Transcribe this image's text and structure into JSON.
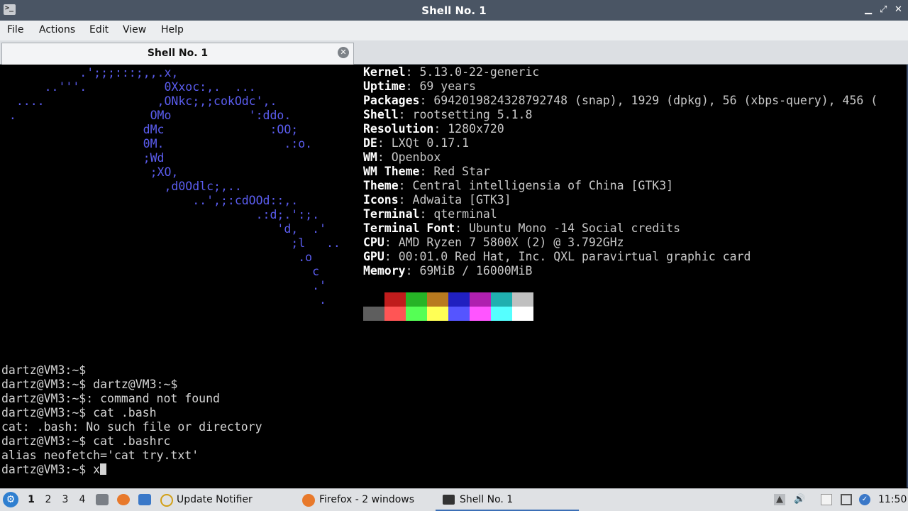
{
  "window": {
    "title": "Shell No. 1",
    "min_label": "▁",
    "max_label": "⤢",
    "close_label": "✕"
  },
  "menu": {
    "file": "File",
    "actions": "Actions",
    "edit": "Edit",
    "view": "View",
    "help": "Help"
  },
  "tab": {
    "label": "Shell No. 1"
  },
  "logo_lines": [
    "           .';;;:::;,,.x,",
    "      ..'''.           0Xxoc:,.  ...",
    "  ....                ,ONkc;,;cokOdc',.",
    " .                   OMo           ':ddo.",
    "                    dMc               :OO;",
    "                    0M.                 .:o.",
    "                    ;Wd",
    "                     ;XO,",
    "                       ,d0Odlc;,..",
    "                           ..',;:cdOOd::,.",
    "                                    .:d;.':;.",
    "                                       'd,  .'",
    "                                         ;l   ..",
    "                                          .o",
    "                                            c",
    "                                            .'",
    "                                             ."
  ],
  "sysinfo": [
    {
      "key": "Kernel",
      "value": "5.13.0-22-generic"
    },
    {
      "key": "Uptime",
      "value": "69 years"
    },
    {
      "key": "Packages",
      "value": "6942019824328792748 (snap), 1929 (dpkg), 56 (xbps-query), 456 ("
    },
    {
      "key": "Shell",
      "value": "rootsetting 5.1.8"
    },
    {
      "key": "Resolution",
      "value": "1280x720"
    },
    {
      "key": "DE",
      "value": "LXQt 0.17.1"
    },
    {
      "key": "WM",
      "value": "Openbox"
    },
    {
      "key": "WM Theme",
      "value": "Red Star"
    },
    {
      "key": "Theme",
      "value": "Central intelligensia of China [GTK3]"
    },
    {
      "key": "Icons",
      "value": "Adwaita [GTK3]"
    },
    {
      "key": "Terminal",
      "value": "qterminal"
    },
    {
      "key": "Terminal Font",
      "value": "Ubuntu Mono -14 Social credits"
    },
    {
      "key": "CPU",
      "value": "AMD Ryzen 7 5800X (2) @ 3.792GHz"
    },
    {
      "key": "GPU",
      "value": "00:01.0 Red Hat, Inc. QXL paravirtual graphic card"
    },
    {
      "key": "Memory",
      "value": "69MiB / 16000MiB"
    }
  ],
  "palette": {
    "row1": [
      "#000000",
      "#c01c1c",
      "#26b426",
      "#b87a1f",
      "#2020c0",
      "#b020b0",
      "#20b0b0",
      "#c0c0c0"
    ],
    "row2": [
      "#5e5e5e",
      "#ff5555",
      "#55ff55",
      "#ffff55",
      "#5555ff",
      "#ff55ff",
      "#55ffff",
      "#ffffff"
    ]
  },
  "terminal_lines": [
    "dartz@VM3:~$",
    "dartz@VM3:~$ dartz@VM3:~$",
    "dartz@VM3:~$: command not found",
    "dartz@VM3:~$ cat .bash",
    "cat: .bash: No such file or directory",
    "dartz@VM3:~$ cat .bashrc",
    "alias neofetch='cat try.txt'"
  ],
  "prompt": {
    "text": "dartz@VM3:~$ x"
  },
  "taskbar": {
    "start_icon": "lxqt-start-icon",
    "desktops": [
      "1",
      "2",
      "3",
      "4"
    ],
    "tasks": {
      "notifier": "Update Notifier",
      "firefox": "Firefox - 2 windows",
      "shell": "Shell No. 1"
    },
    "clock": "11:50"
  }
}
